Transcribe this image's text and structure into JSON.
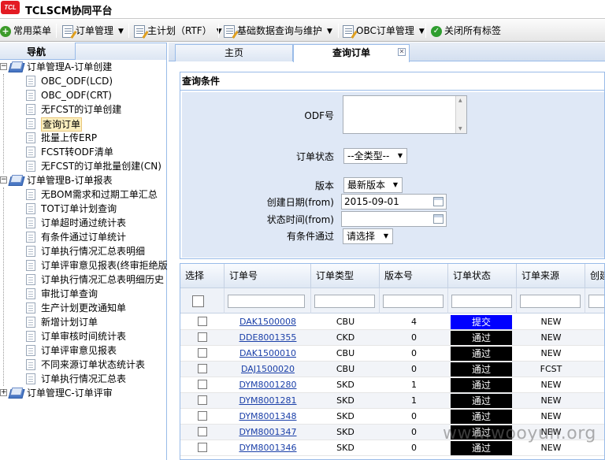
{
  "app": {
    "logo_text": "TCL",
    "title": "TCLSCM协同平台"
  },
  "toolbar": {
    "common_menu": "常用菜单",
    "order_mgmt": "订单管理",
    "master_plan": "主计划（RTF）",
    "basic_data": "基础数据查询与维护",
    "obc_order": "OBC订单管理",
    "close_all_tabs": "关闭所有标签"
  },
  "nav": {
    "title": "导航",
    "groups": [
      {
        "label": "订单管理A-订单创建",
        "items": [
          "OBC_ODF(LCD)",
          "OBC_ODF(CRT)",
          "无FCST的订单创建",
          "查询订单",
          "批量上传ERP",
          "FCST转ODF清单",
          "无FCST的订单批量创建(CN)"
        ]
      },
      {
        "label": "订单管理B-订单报表",
        "items": [
          "无BOM需求和过期工单汇总",
          "TOT订单计划查询",
          "订单超时通过统计表",
          "有条件通过订单统计",
          "订单执行情况汇总表明细",
          "订单评审意见报表(终审拒绝版",
          "订单执行情况汇总表明细历史",
          "审批订单查询",
          "生产计划更改通知单",
          "新增计划订单",
          "订单审核时间统计表",
          "订单评审意见报表",
          "不同来源订单状态统计表",
          "订单执行情况汇总表"
        ]
      },
      {
        "label": "订单管理C-订单评审",
        "items": []
      }
    ],
    "selected_item": "查询订单"
  },
  "tabs": [
    {
      "label": "主页"
    },
    {
      "label": "查询订单",
      "close": "✕"
    }
  ],
  "query": {
    "title": "查询条件",
    "odf_label": "ODF号",
    "odf_value": "",
    "status_label": "订单状态",
    "status_value": "--全类型--",
    "version_label": "版本",
    "version_value": "最新版本",
    "create_date_label": "创建日期(from)",
    "create_date_value": "2015-09-01",
    "status_time_label": "状态时间(from)",
    "status_time_value": "",
    "conditional_label": "有条件通过",
    "conditional_value": "请选择"
  },
  "grid": {
    "columns": [
      "选择",
      "订单号",
      "订单类型",
      "版本号",
      "订单状态",
      "订单来源",
      "创建"
    ],
    "rows": [
      {
        "order_no": "DAK1500008",
        "type": "CBU",
        "version": "4",
        "status": "提交",
        "source": "NEW",
        "status_color": "#0000ff"
      },
      {
        "order_no": "DDE8001355",
        "type": "CKD",
        "version": "0",
        "status": "通过",
        "source": "NEW",
        "status_color": "#000000"
      },
      {
        "order_no": "DAK1500010",
        "type": "CBU",
        "version": "0",
        "status": "通过",
        "source": "NEW",
        "status_color": "#000000"
      },
      {
        "order_no": "DAJ1500020",
        "type": "CBU",
        "version": "0",
        "status": "通过",
        "source": "FCST",
        "status_color": "#000000"
      },
      {
        "order_no": "DYM8001280",
        "type": "SKD",
        "version": "1",
        "status": "通过",
        "source": "NEW",
        "status_color": "#000000"
      },
      {
        "order_no": "DYM8001281",
        "type": "SKD",
        "version": "1",
        "status": "通过",
        "source": "NEW",
        "status_color": "#000000"
      },
      {
        "order_no": "DYM8001348",
        "type": "SKD",
        "version": "0",
        "status": "通过",
        "source": "NEW",
        "status_color": "#000000"
      },
      {
        "order_no": "DYM8001347",
        "type": "SKD",
        "version": "0",
        "status": "通过",
        "source": "NEW",
        "status_color": "#000000"
      },
      {
        "order_no": "DYM8001346",
        "type": "SKD",
        "version": "0",
        "status": "通过",
        "source": "NEW",
        "status_color": "#000000"
      }
    ]
  },
  "watermark": "www.wooyun.org"
}
